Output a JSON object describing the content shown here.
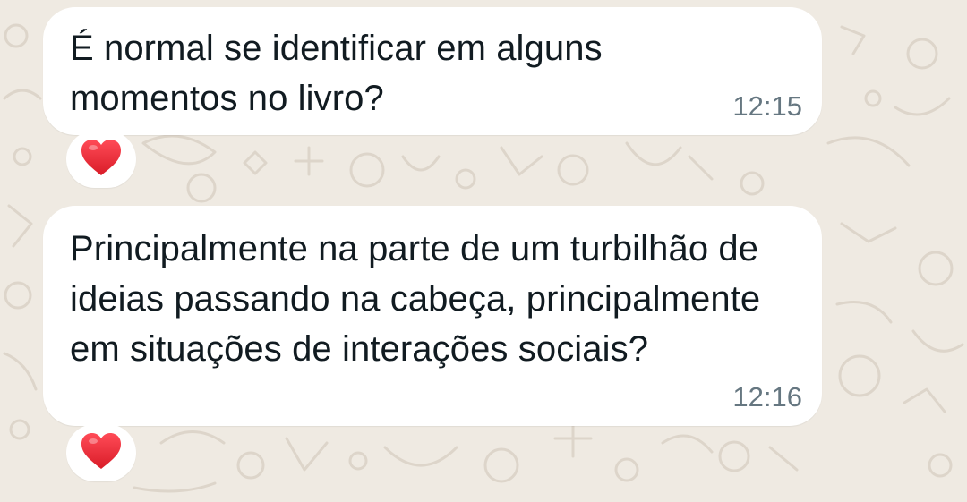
{
  "messages": [
    {
      "text": "É normal se identificar em alguns momentos no livro?",
      "time": "12:15",
      "reaction": "heart-icon"
    },
    {
      "text": "Principalmente na parte de um turbilhão de ideias passando na cabeça, principalmente em situações de interações sociais?",
      "time": "12:16",
      "reaction": "heart-icon"
    }
  ],
  "colors": {
    "background": "#efeae2",
    "bubble": "#ffffff",
    "text": "#111b21",
    "timestamp": "#667781",
    "reaction_heart": "#e0222e"
  }
}
